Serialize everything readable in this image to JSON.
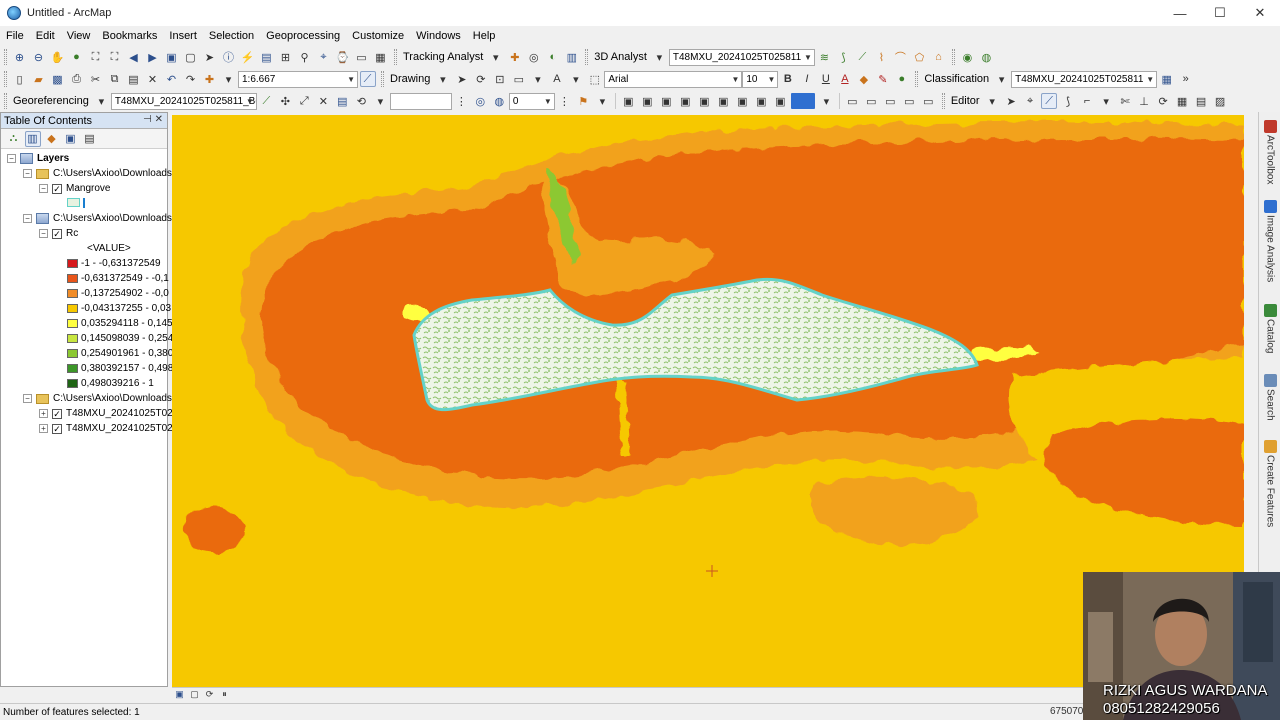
{
  "window": {
    "title": "Untitled - ArcMap",
    "controls": [
      "—",
      "☐",
      "✕"
    ]
  },
  "menu": [
    "File",
    "Edit",
    "View",
    "Bookmarks",
    "Insert",
    "Selection",
    "Geoprocessing",
    "Customize",
    "Windows",
    "Help"
  ],
  "toolbars": {
    "tracking_analyst": "Tracking Analyst",
    "analyst_3d": "3D Analyst",
    "layer_combo_1": "T48MXU_20241025T025811",
    "scale": "1:6.667",
    "drawing": "Drawing",
    "font": "Arial",
    "font_size": "10",
    "bold": "B",
    "italic": "I",
    "underline": "U",
    "font_color": "A",
    "classification": "Classification",
    "layer_combo_2": "T48MXU_20241025T025811",
    "georeferencing": "Georeferencing",
    "geo_layer_combo": "T48MXU_20241025T025811_B(",
    "band_value": "0",
    "editor": "Editor"
  },
  "toc": {
    "title": "Table Of Contents",
    "root": "Layers",
    "groups": [
      {
        "path": "C:\\Users\\Axioo\\Downloads",
        "layers": [
          {
            "name": "Mangrove",
            "checked": true
          }
        ]
      },
      {
        "path": "C:\\Users\\Axioo\\Downloads",
        "layers": [
          {
            "name": "Rc",
            "checked": true
          }
        ],
        "legend_title": "<VALUE>",
        "legend": [
          {
            "label": "-1 - -0,631372549",
            "color": "#d7191c"
          },
          {
            "label": "-0,631372549 - -0,1",
            "color": "#e8551a"
          },
          {
            "label": "-0,137254902 - -0,0",
            "color": "#f08c28"
          },
          {
            "label": "-0,043137255 - 0,03",
            "color": "#f6c800"
          },
          {
            "label": "0,035294118 - 0,145",
            "color": "#ffff40"
          },
          {
            "label": "0,145098039 - 0,254",
            "color": "#c8e640"
          },
          {
            "label": "0,254901961 - 0,380",
            "color": "#8cc832"
          },
          {
            "label": "0,380392157 - 0,498",
            "color": "#3c9628"
          },
          {
            "label": "0,498039216 - 1",
            "color": "#1e6414"
          }
        ]
      },
      {
        "path": "C:\\Users\\Axioo\\Downloads",
        "layers": [
          {
            "name": "T48MXU_20241025T02",
            "checked": true
          },
          {
            "name": "T48MXU_20241025T02",
            "checked": true
          }
        ]
      }
    ]
  },
  "dock_tabs": [
    "ArcToolbox",
    "Image Analysis",
    "Catalog",
    "Search",
    "Create Features"
  ],
  "status": {
    "selected": "Number of features selected: 1",
    "coords": "675070"
  },
  "webcam": {
    "name": "RIZKI AGUS WARDANA",
    "phone": "08051282429056"
  },
  "colors": {
    "map_background": "#f6c800",
    "orange": "#f08c28",
    "dark_orange": "#e8651a",
    "mangrove_fill": "#e8f2e0",
    "mangrove_outline": "#64d2c8",
    "accent": "#2c4f8c"
  }
}
